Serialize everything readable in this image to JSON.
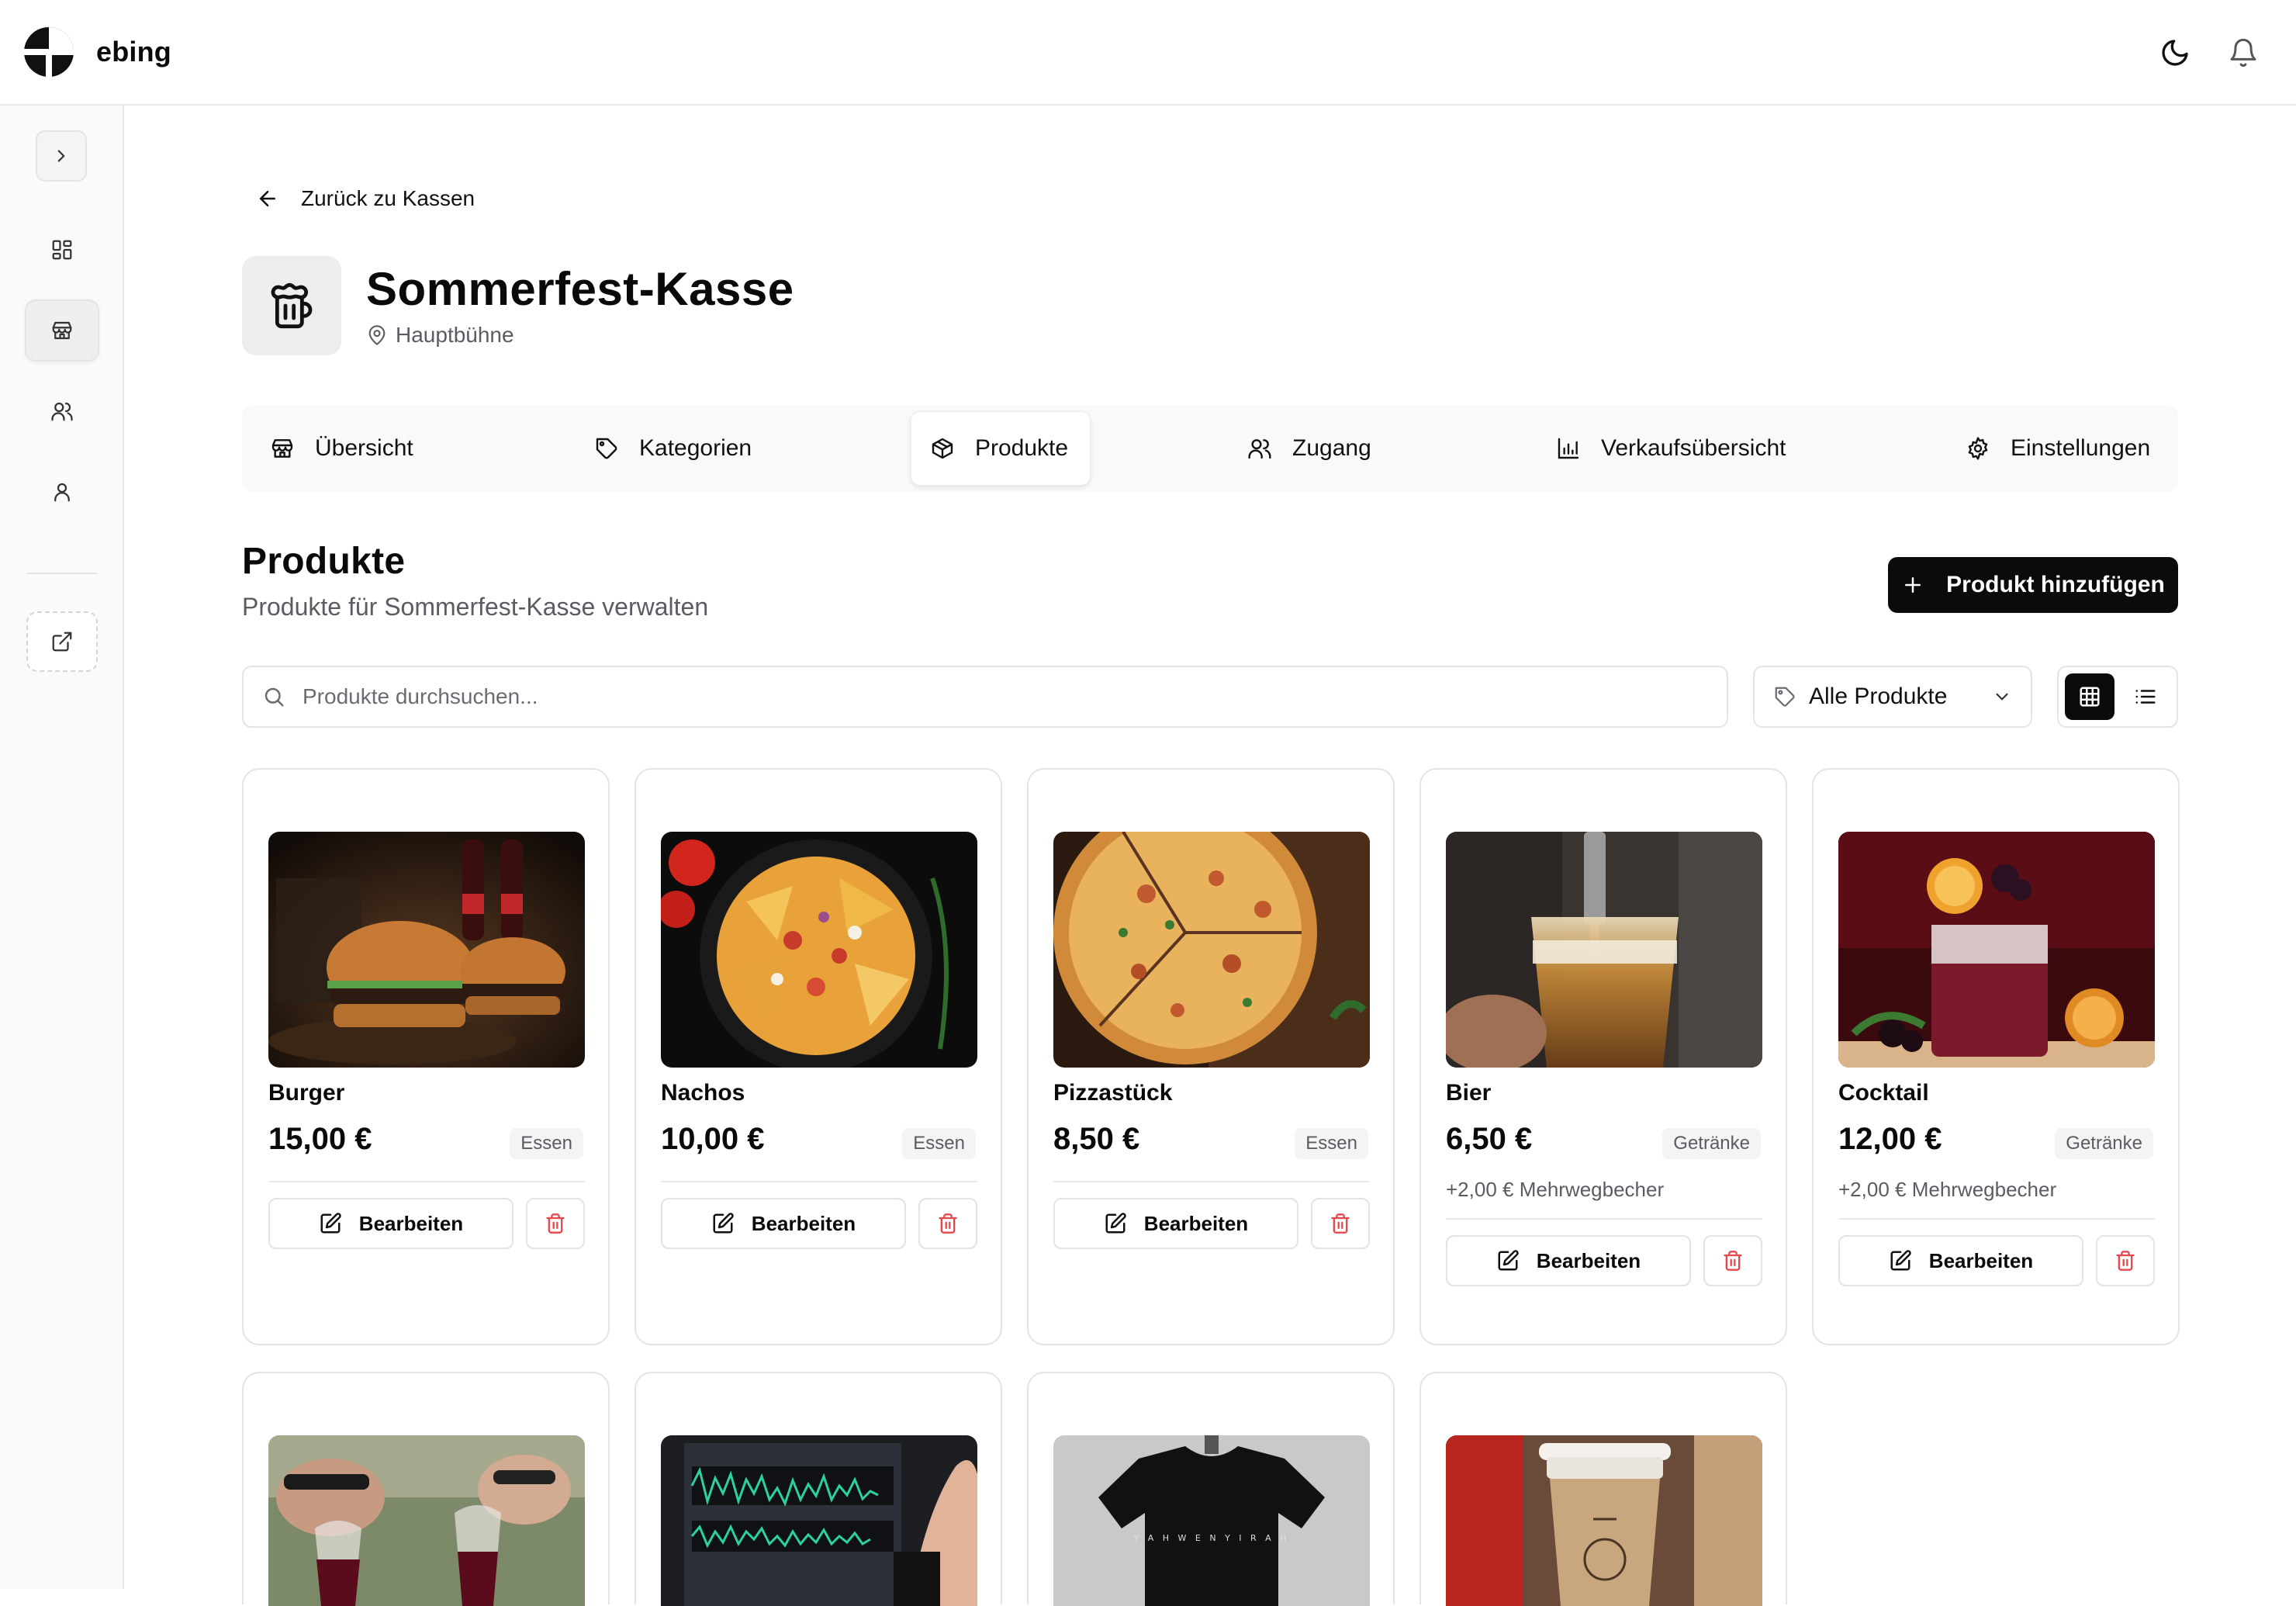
{
  "app": {
    "name": "ebing"
  },
  "topbar": {
    "theme_icon": "moon-icon",
    "notify_icon": "bell-icon"
  },
  "sidebar": {
    "items": [
      {
        "icon": "chevron-right-icon",
        "name": "toggle"
      },
      {
        "icon": "dashboard-icon",
        "name": "dashboard"
      },
      {
        "icon": "store-icon",
        "name": "kassen",
        "active": true
      },
      {
        "icon": "users-icon",
        "name": "team"
      },
      {
        "icon": "user-icon",
        "name": "profile"
      },
      {
        "icon": "external-link-icon",
        "name": "external"
      }
    ]
  },
  "page": {
    "back_label": "Zurück zu Kassen",
    "title": "Sommerfest-Kasse",
    "location": "Hauptbühne"
  },
  "tabs": [
    {
      "label": "Übersicht",
      "icon": "store-icon"
    },
    {
      "label": "Kategorien",
      "icon": "tag-icon"
    },
    {
      "label": "Produkte",
      "icon": "package-icon",
      "active": true
    },
    {
      "label": "Zugang",
      "icon": "users-icon"
    },
    {
      "label": "Verkaufsübersicht",
      "icon": "bar-chart-icon"
    },
    {
      "label": "Einstellungen",
      "icon": "gear-icon"
    }
  ],
  "products_section": {
    "title": "Produkte",
    "subtitle": "Produkte für Sommerfest-Kasse verwalten",
    "add_button": "Produkt hinzufügen",
    "search_placeholder": "Produkte durchsuchen...",
    "filter_value": "Alle Produkte",
    "view_mode": "grid"
  },
  "products": [
    {
      "name": "Burger",
      "price": "15,00 €",
      "category": "Essen",
      "extra": "",
      "edit_label": "Bearbeiten",
      "image": "burger"
    },
    {
      "name": "Nachos",
      "price": "10,00 €",
      "category": "Essen",
      "extra": "",
      "edit_label": "Bearbeiten",
      "image": "nachos"
    },
    {
      "name": "Pizzastück",
      "price": "8,50 €",
      "category": "Essen",
      "extra": "",
      "edit_label": "Bearbeiten",
      "image": "pizza"
    },
    {
      "name": "Bier",
      "price": "6,50 €",
      "category": "Getränke",
      "extra": "+2,00 € Mehrwegbecher",
      "edit_label": "Bearbeiten",
      "image": "beer"
    },
    {
      "name": "Cocktail",
      "price": "12,00 €",
      "category": "Getränke",
      "extra": "+2,00 € Mehrwegbecher",
      "edit_label": "Bearbeiten",
      "image": "cocktail"
    }
  ],
  "products_row2_images": [
    "wine",
    "audio",
    "tshirt",
    "coffee"
  ],
  "colors": {
    "primary": "#0b0b0d",
    "danger": "#e5484d",
    "muted": "#5b5b63",
    "border": "#e4e4e7"
  }
}
